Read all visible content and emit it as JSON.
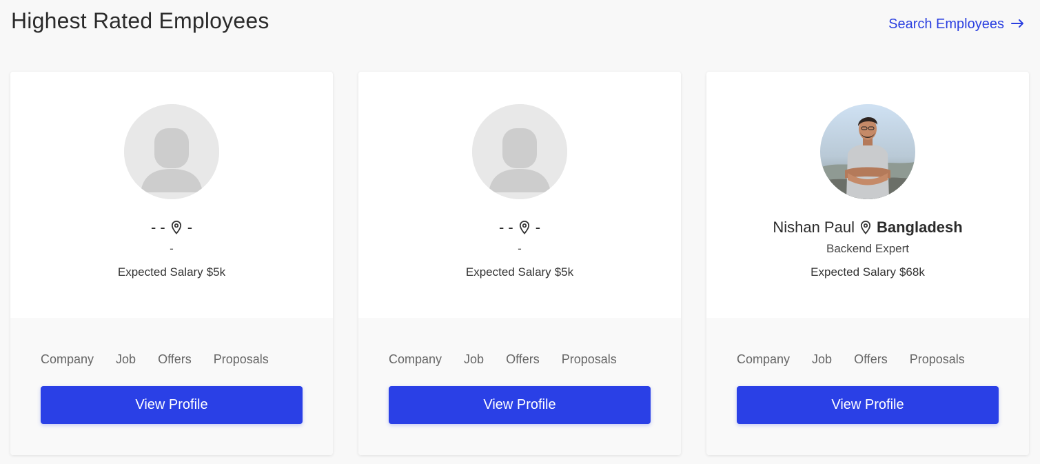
{
  "header": {
    "title": "Highest Rated Employees",
    "search_link": "Search Employees",
    "search_icon": "arrow-right-icon"
  },
  "colors": {
    "accent": "#2a40e6",
    "background": "#f8f8f8",
    "card_bottom": "#f9f9f9"
  },
  "cards": [
    {
      "avatar": "placeholder-avatar",
      "name": "- -",
      "location_icon": "map-pin-icon",
      "country": "-",
      "role": "-",
      "salary_label": "Expected Salary",
      "salary_value": "$5k",
      "stats": [
        "Company",
        "Job",
        "Offers",
        "Proposals"
      ],
      "button": "View Profile"
    },
    {
      "avatar": "placeholder-avatar",
      "name": "- -",
      "location_icon": "map-pin-icon",
      "country": "-",
      "role": "-",
      "salary_label": "Expected Salary",
      "salary_value": "$5k",
      "stats": [
        "Company",
        "Job",
        "Offers",
        "Proposals"
      ],
      "button": "View Profile"
    },
    {
      "avatar": "photo-avatar",
      "name": "Nishan Paul",
      "location_icon": "map-pin-icon",
      "country": "Bangladesh",
      "role": "Backend Expert",
      "salary_label": "Expected Salary",
      "salary_value": "$68k",
      "stats": [
        "Company",
        "Job",
        "Offers",
        "Proposals"
      ],
      "button": "View Profile"
    }
  ]
}
